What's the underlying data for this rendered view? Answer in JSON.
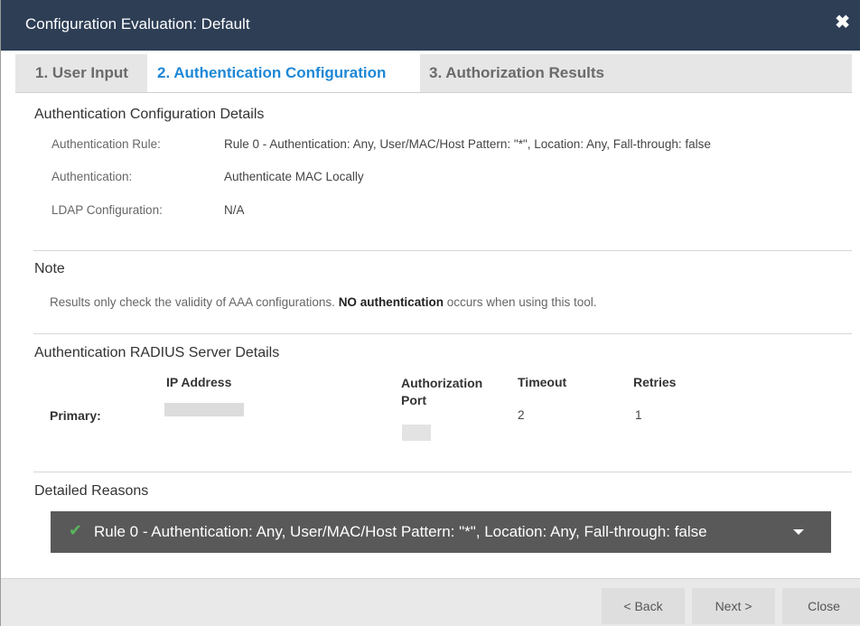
{
  "window": {
    "title": "Configuration Evaluation: Default",
    "close_glyph": "✖"
  },
  "tabs": [
    {
      "label": "1. User Input",
      "active": false
    },
    {
      "label": "2. Authentication Configuration",
      "active": true
    },
    {
      "label": "3. Authorization Results",
      "active": false
    }
  ],
  "auth_config": {
    "heading": "Authentication Configuration Details",
    "rows": [
      {
        "label": "Authentication Rule:",
        "value": "Rule 0 - Authentication: Any, User/MAC/Host Pattern: \"*\", Location: Any, Fall-through: false"
      },
      {
        "label": "Authentication:",
        "value": "Authenticate MAC Locally"
      },
      {
        "label": "LDAP Configuration:",
        "value": "N/A"
      }
    ]
  },
  "note": {
    "heading": "Note",
    "text_before": "Results only check the validity of AAA configurations.",
    "text_bold": "NO authentication",
    "text_after": "occurs when using this tool."
  },
  "radius": {
    "heading": "Authentication RADIUS Server Details",
    "columns": {
      "ip": "IP Address",
      "port": "Authorization Port",
      "timeout": "Timeout",
      "retries": "Retries"
    },
    "primary": {
      "label": "Primary:",
      "timeout": "2",
      "retries": "1"
    }
  },
  "reasons": {
    "heading": "Detailed Reasons",
    "items": [
      {
        "icon": "check-icon",
        "text": "Rule 0 - Authentication: Any, User/MAC/Host Pattern: \"*\", Location: Any, Fall-through: false"
      }
    ]
  },
  "buttons": {
    "back": "< Back",
    "next": "Next >",
    "close": "Close"
  },
  "colors": {
    "titlebar": "#2d3e55",
    "active_tab": "#1e88d6",
    "reason_bar": "#595959",
    "check": "#58b65a"
  }
}
